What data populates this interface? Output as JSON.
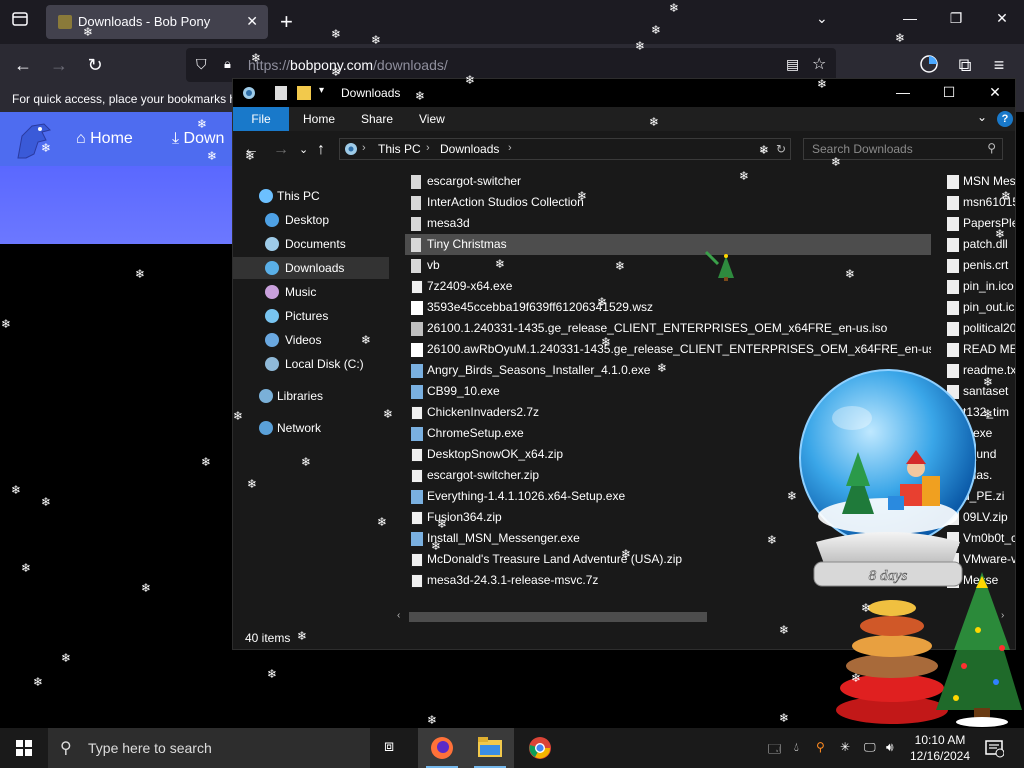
{
  "browser": {
    "tab_title": "Downloads - Bob Pony",
    "url_domain": "bobpony.com",
    "url_prefix": "https://",
    "url_path": "/downloads/",
    "bookmarks_hint": "For quick access, place your bookmarks h"
  },
  "site": {
    "nav_home": "Home",
    "nav_downloads": "Down"
  },
  "explorer": {
    "title": "Downloads",
    "ribbon": {
      "file": "File",
      "home": "Home",
      "share": "Share",
      "view": "View",
      "help": "?"
    },
    "breadcrumb": [
      "This PC",
      "Downloads"
    ],
    "search_placeholder": "Search Downloads",
    "nav": [
      {
        "label": "This PC",
        "color": "#6cc0ff"
      },
      {
        "label": "Desktop",
        "color": "#4ea1e5"
      },
      {
        "label": "Documents",
        "color": "#9ecbe8"
      },
      {
        "label": "Downloads",
        "color": "#5ab0e8"
      },
      {
        "label": "Music",
        "color": "#c9a0dc"
      },
      {
        "label": "Pictures",
        "color": "#78c4f0"
      },
      {
        "label": "Videos",
        "color": "#6aa8e0"
      },
      {
        "label": "Local Disk (C:)",
        "color": "#8fb9d8"
      },
      {
        "label": "Libraries",
        "color": "#7ab0d8"
      },
      {
        "label": "Network",
        "color": "#5aa0d8"
      }
    ],
    "files": [
      {
        "name": "escargot-switcher",
        "kind": "folder"
      },
      {
        "name": "InterAction Studios Collection",
        "kind": "folder"
      },
      {
        "name": "mesa3d",
        "kind": "folder"
      },
      {
        "name": "Tiny Christmas",
        "kind": "folder"
      },
      {
        "name": "vb",
        "kind": "folder"
      },
      {
        "name": "7z2409-x64.exe",
        "kind": "7z"
      },
      {
        "name": "3593e45ccebba19f639ff61206341529.wsz",
        "kind": "doc"
      },
      {
        "name": "26100.1.240331-1435.ge_release_CLIENT_ENTERPRISES_OEM_x64FRE_en-us.iso",
        "kind": "iso"
      },
      {
        "name": "26100.awRbOyuM.1.240331-1435.ge_release_CLIENT_ENTERPRISES_OEM_x64FRE_en-us.iso.part",
        "kind": "doc"
      },
      {
        "name": "Angry_Birds_Seasons_Installer_4.1.0.exe",
        "kind": "exe"
      },
      {
        "name": "CB99_10.exe",
        "kind": "exe"
      },
      {
        "name": "ChickenInvaders2.7z",
        "kind": "7z"
      },
      {
        "name": "ChromeSetup.exe",
        "kind": "exe"
      },
      {
        "name": "DesktopSnowOK_x64.zip",
        "kind": "7z"
      },
      {
        "name": "escargot-switcher.zip",
        "kind": "7z"
      },
      {
        "name": "Everything-1.4.1.1026.x64-Setup.exe",
        "kind": "exe"
      },
      {
        "name": "Fusion364.zip",
        "kind": "7z"
      },
      {
        "name": "Install_MSN_Messenger.exe",
        "kind": "exe"
      },
      {
        "name": "McDonald's Treasure Land Adventure (USA).zip",
        "kind": "7z"
      },
      {
        "name": "mesa3d-24.3.1-release-msvc.7z",
        "kind": "7z"
      }
    ],
    "files_col2": [
      "MSN Mes",
      "msn61015",
      "PapersPle",
      "patch.dll",
      "penis.crt",
      "pin_in.ico",
      "pin_out.ic",
      "political20",
      "READ ME.",
      "readme.tx",
      "santaset",
      "t132_tim",
      "p.exe",
      "p_und",
      "tmas.",
      "d_PE.zi",
      "09LV.zip",
      "Vm0b0t_c",
      "VMware-v",
      "Messe"
    ],
    "status": "40 items"
  },
  "globe": {
    "label": "8 days"
  },
  "taskbar": {
    "search_placeholder": "Type here to search",
    "time": "10:10 AM",
    "date": "12/16/2024"
  },
  "colors": {
    "accent": "#1979ca",
    "site_blue": "#4e6cf0"
  }
}
